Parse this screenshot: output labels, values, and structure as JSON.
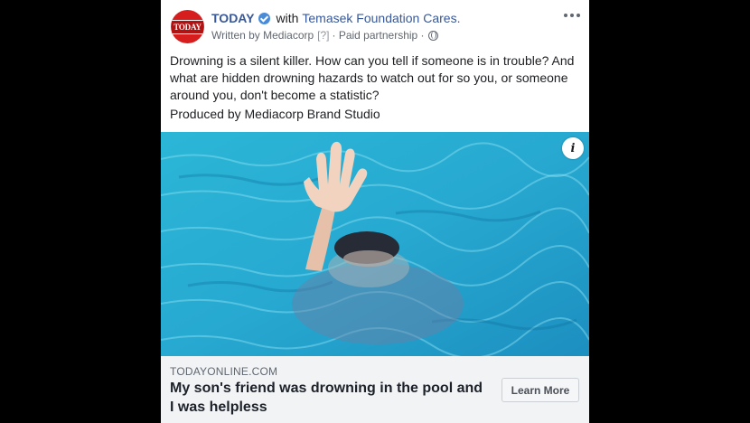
{
  "post": {
    "page_name": "TODAY",
    "with_text": "with",
    "partner": "Temasek Foundation Cares.",
    "written_by": "Written by Mediacorp",
    "question_mark": "[?]",
    "paid": "· Paid partnership ·",
    "avatar_text": "TODAY",
    "body": "Drowning is a silent killer. How can you tell if someone is in trouble? And what are hidden drowning hazards to watch out for so you, or someone around you, don't become a statistic?",
    "produced_by": "Produced by Mediacorp Brand Studio",
    "info_glyph": "i"
  },
  "link": {
    "domain": "TODAYONLINE.COM",
    "headline": "My son's friend was drowning in the pool and I was helpless",
    "cta": "Learn More"
  },
  "colors": {
    "page_link": "#385898",
    "verified": "#4a8bd8",
    "avatar_bg": "#d71e1e"
  }
}
